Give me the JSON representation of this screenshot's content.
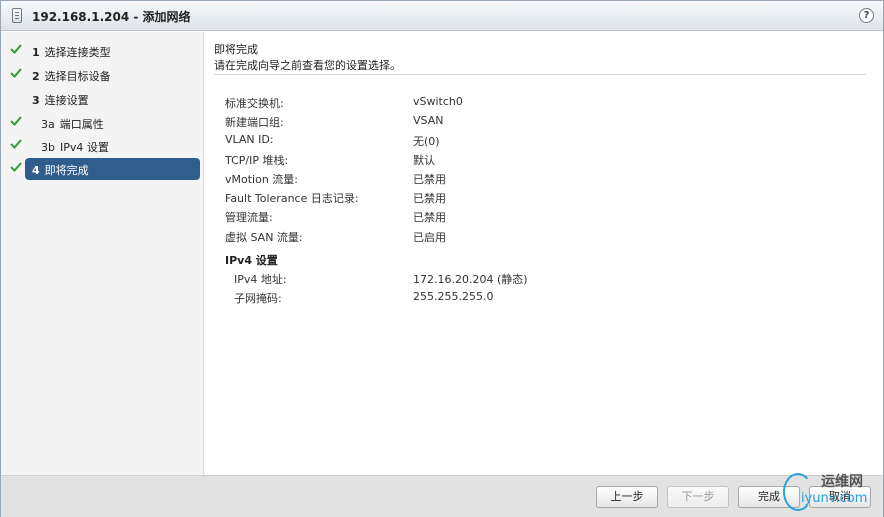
{
  "window": {
    "title": "192.168.1.204 - 添加网络",
    "help_label": "?"
  },
  "steps": [
    {
      "num": "1",
      "label": "选择连接类型",
      "done": true
    },
    {
      "num": "2",
      "label": "选择目标设备",
      "done": true
    },
    {
      "num": "3",
      "label": "连接设置",
      "done": false
    },
    {
      "num": "3a",
      "label": "端口属性",
      "done": true
    },
    {
      "num": "3b",
      "label": "IPv4 设置",
      "done": true
    },
    {
      "num": "4",
      "label": "即将完成",
      "done": true,
      "active": true
    }
  ],
  "main": {
    "title": "即将完成",
    "subtitle": "请在完成向导之前查看您的设置选择。",
    "rows": [
      {
        "key": "标准交换机:",
        "value": "vSwitch0"
      },
      {
        "key": "新建端口组:",
        "value": "VSAN"
      },
      {
        "key": "VLAN ID:",
        "value": "无(0)"
      },
      {
        "key": "TCP/IP 堆栈:",
        "value": "默认"
      },
      {
        "key": "vMotion 流量:",
        "value": "已禁用"
      },
      {
        "key": "Fault Tolerance 日志记录:",
        "value": "已禁用"
      },
      {
        "key": "管理流量:",
        "value": "已禁用"
      },
      {
        "key": "虚拟 SAN 流量:",
        "value": "已启用"
      }
    ],
    "ipv4_section": "IPv4 设置",
    "ipv4_rows": [
      {
        "key": "IPv4 地址:",
        "value": "172.16.20.204 (静态)"
      },
      {
        "key": "子网掩码:",
        "value": "255.255.255.0"
      }
    ]
  },
  "footer": {
    "back": "上一步",
    "next": "下一步",
    "finish": "完成",
    "cancel": "取消"
  },
  "watermark": {
    "cn": "运维网",
    "en": "iyunv.com"
  },
  "colors": {
    "accent": "#2f5e8c",
    "check": "#3a9a3a"
  }
}
